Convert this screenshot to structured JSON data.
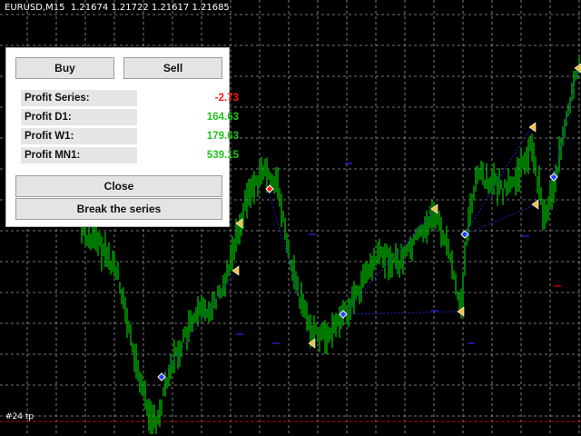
{
  "chart_header": {
    "symbol": "EURUSD,M15",
    "prices": "1.21674 1.21722 1.21617 1.21685"
  },
  "marker_label": "#24 tp",
  "panel": {
    "buy_label": "Buy",
    "sell_label": "Sell",
    "rows": [
      {
        "label": "Profit Series:",
        "value": "-2.73",
        "color": "#ff1a1a"
      },
      {
        "label": "Profit D1:",
        "value": "164.63",
        "color": "#22c41e"
      },
      {
        "label": "Profit W1:",
        "value": "179.63",
        "color": "#22c41e"
      },
      {
        "label": "Profit MN1:",
        "value": "539.15",
        "color": "#22c41e"
      }
    ],
    "close_label": "Close",
    "break_label": "Break the series"
  },
  "colors": {
    "background": "#000000",
    "candles": "#00c800",
    "grid": "#9a9a9a",
    "trade_line": "#2020c8",
    "take_profit_line": "#c00000"
  }
}
